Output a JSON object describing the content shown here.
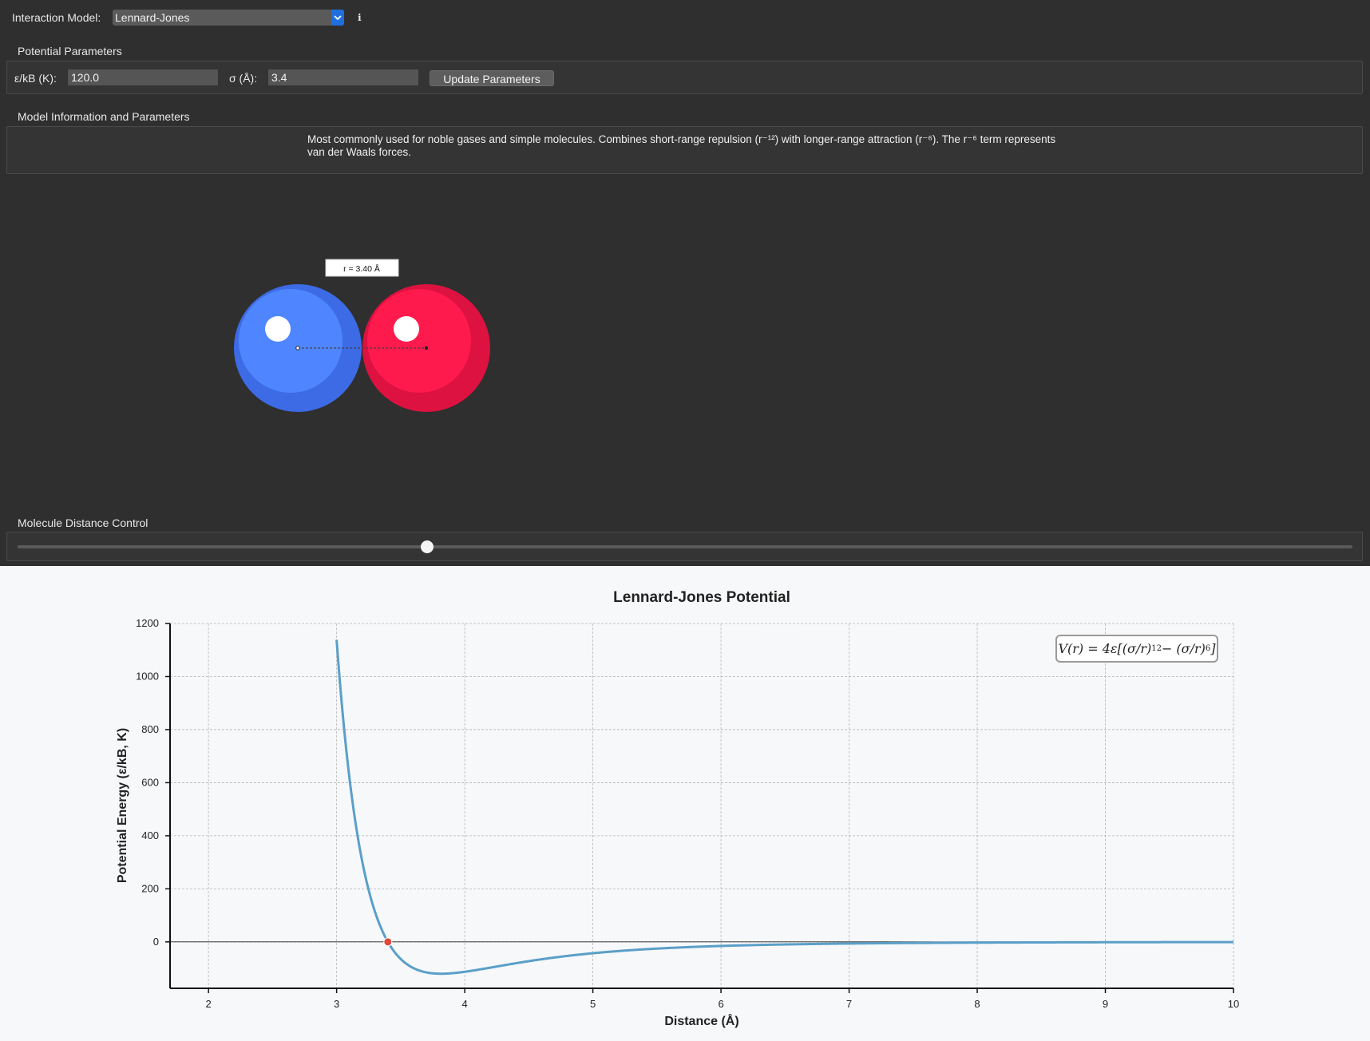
{
  "toolbar": {
    "model_label": "Interaction Model:",
    "model_value": "Lennard-Jones",
    "info_glyph": "ℹ"
  },
  "potential_params": {
    "title": "Potential Parameters",
    "epsilon_label": "ε/kB (K):",
    "epsilon_value": "120.0",
    "sigma_label": "σ (Å):",
    "sigma_value": "3.4",
    "update_button": "Update Parameters"
  },
  "model_info": {
    "title": "Model Information and Parameters",
    "description_line1": "Most commonly used for noble gases and simple molecules. Combines short-range repulsion (r⁻¹²) with longer-range attraction (r⁻⁶). The r⁻⁶ term represents",
    "description_line2": "van der Waals forces."
  },
  "visualization": {
    "distance_label": "r = 3.40 Å",
    "molecule_a_color": "#4f86ff",
    "molecule_b_color": "#ff1a4d"
  },
  "distance_control": {
    "title": "Molecule Distance Control",
    "slider_fraction": 0.307
  },
  "chart_data": {
    "type": "line",
    "title": "Lennard-Jones Potential",
    "xlabel": "Distance (Å)",
    "ylabel": "Potential Energy (ε/kB, K)",
    "xlim": [
      1.7,
      10
    ],
    "ylim": [
      -175,
      1200
    ],
    "xticks": [
      2,
      3,
      4,
      5,
      6,
      7,
      8,
      9,
      10
    ],
    "yticks": [
      0,
      200,
      400,
      600,
      800,
      1000,
      1200
    ],
    "grid": true,
    "series": [
      {
        "function": "4*eps*((sigma/r)^12-(sigma/r)^6)",
        "epsilon": 120,
        "sigma": 3.4,
        "x_range": [
          3.0,
          10
        ],
        "color": "#5a9fc8"
      }
    ],
    "marker": {
      "x": 3.4,
      "y": 0,
      "color": "#e0483a"
    },
    "formula_prefix": "V(r) = 4ε[(σ/r)",
    "formula_exp1": "12",
    "formula_middle": " − (σ/r)",
    "formula_exp2": "6",
    "formula_suffix": "]"
  }
}
